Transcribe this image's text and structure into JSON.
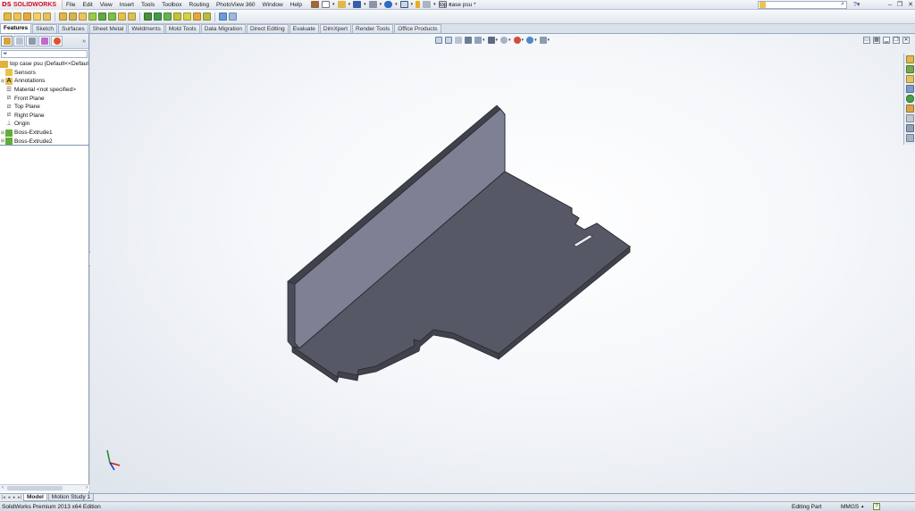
{
  "app": {
    "brand": "SOLIDWORKS",
    "brand_mark": "DS",
    "brand_color": "#c8102e",
    "document_title": "top case psu *"
  },
  "menu": [
    "File",
    "Edit",
    "View",
    "Insert",
    "Tools",
    "Toolbox",
    "Routing",
    "PhotoView 360",
    "Window",
    "Help"
  ],
  "search": {
    "placeholder": "",
    "value": ""
  },
  "command_tabs": [
    "Features",
    "Sketch",
    "Surfaces",
    "Sheet Metal",
    "Weldments",
    "Mold Tools",
    "Data Migration",
    "Direct Editing",
    "Evaluate",
    "DimXpert",
    "Render Tools",
    "Office Products"
  ],
  "active_command_tab": "Features",
  "feature_tree": {
    "root": "top case psu  (Default<<Defaul",
    "items": [
      {
        "label": "Sensors",
        "icon": "sensors-icon",
        "expandable": false
      },
      {
        "label": "Annotations",
        "icon": "annotations-icon",
        "expandable": true
      },
      {
        "label": "Material <not specified>",
        "icon": "material-icon",
        "expandable": false
      },
      {
        "label": "Front Plane",
        "icon": "plane-icon",
        "expandable": false
      },
      {
        "label": "Top Plane",
        "icon": "plane-icon",
        "expandable": false
      },
      {
        "label": "Right Plane",
        "icon": "plane-icon",
        "expandable": false
      },
      {
        "label": "Origin",
        "icon": "origin-icon",
        "expandable": false
      },
      {
        "label": "Boss-Extrude1",
        "icon": "extrude-icon",
        "expandable": true
      },
      {
        "label": "Boss-Extrude2",
        "icon": "extrude-icon",
        "expandable": true
      }
    ]
  },
  "bottom_tabs": [
    "Model",
    "Motion Study 1"
  ],
  "active_bottom_tab": "Model",
  "status": {
    "edition": "SolidWorks Premium 2013 x64 Edition",
    "mode": "Editing Part",
    "units": "MMGS"
  },
  "colors": {
    "part_top": "#565965",
    "part_wall": "#7d8193",
    "part_edge": "#2c2e36",
    "part_side": "#40424c"
  }
}
